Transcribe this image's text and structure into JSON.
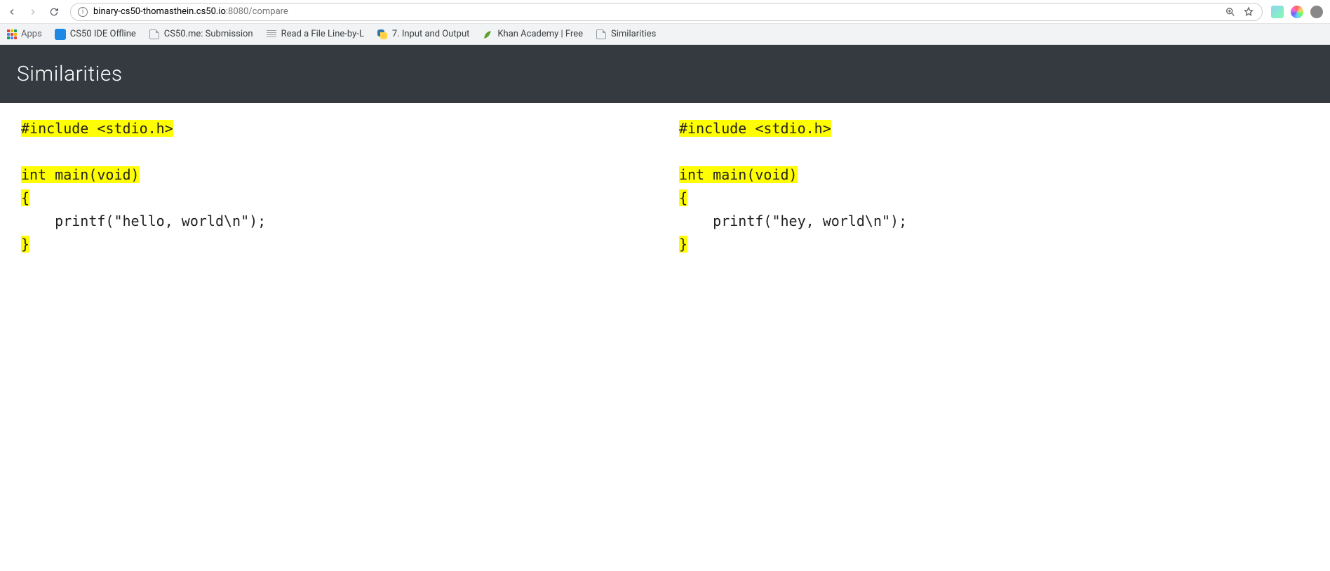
{
  "browser": {
    "url_host": "binary-cs50-thomasthein.cs50.io",
    "url_port": ":8080",
    "url_path": "/compare"
  },
  "bookmarks": {
    "apps_label": "Apps",
    "items": [
      {
        "label": "CS50 IDE Offline",
        "icon": "blue"
      },
      {
        "label": "CS50.me: Submission",
        "icon": "generic"
      },
      {
        "label": "Read a File Line-by-L",
        "icon": "lines"
      },
      {
        "label": "7. Input and Output",
        "icon": "python"
      },
      {
        "label": "Khan Academy | Free",
        "icon": "leaf"
      },
      {
        "label": "Similarities",
        "icon": "generic"
      }
    ]
  },
  "header": {
    "title": "Similarities"
  },
  "panes": {
    "left": {
      "lines": [
        {
          "text": "#include <stdio.h>",
          "highlight": true
        },
        {
          "text": "",
          "highlight": false
        },
        {
          "text": "int main(void)",
          "highlight": true
        },
        {
          "text": "{",
          "highlight": true
        },
        {
          "text": "    printf(\"hello, world\\n\");",
          "highlight": false
        },
        {
          "text": "}",
          "highlight": true
        }
      ]
    },
    "right": {
      "lines": [
        {
          "text": "#include <stdio.h>",
          "highlight": true
        },
        {
          "text": "",
          "highlight": false
        },
        {
          "text": "int main(void)",
          "highlight": true
        },
        {
          "text": "{",
          "highlight": true
        },
        {
          "text": "    printf(\"hey, world\\n\");",
          "highlight": false
        },
        {
          "text": "}",
          "highlight": true
        }
      ]
    }
  }
}
